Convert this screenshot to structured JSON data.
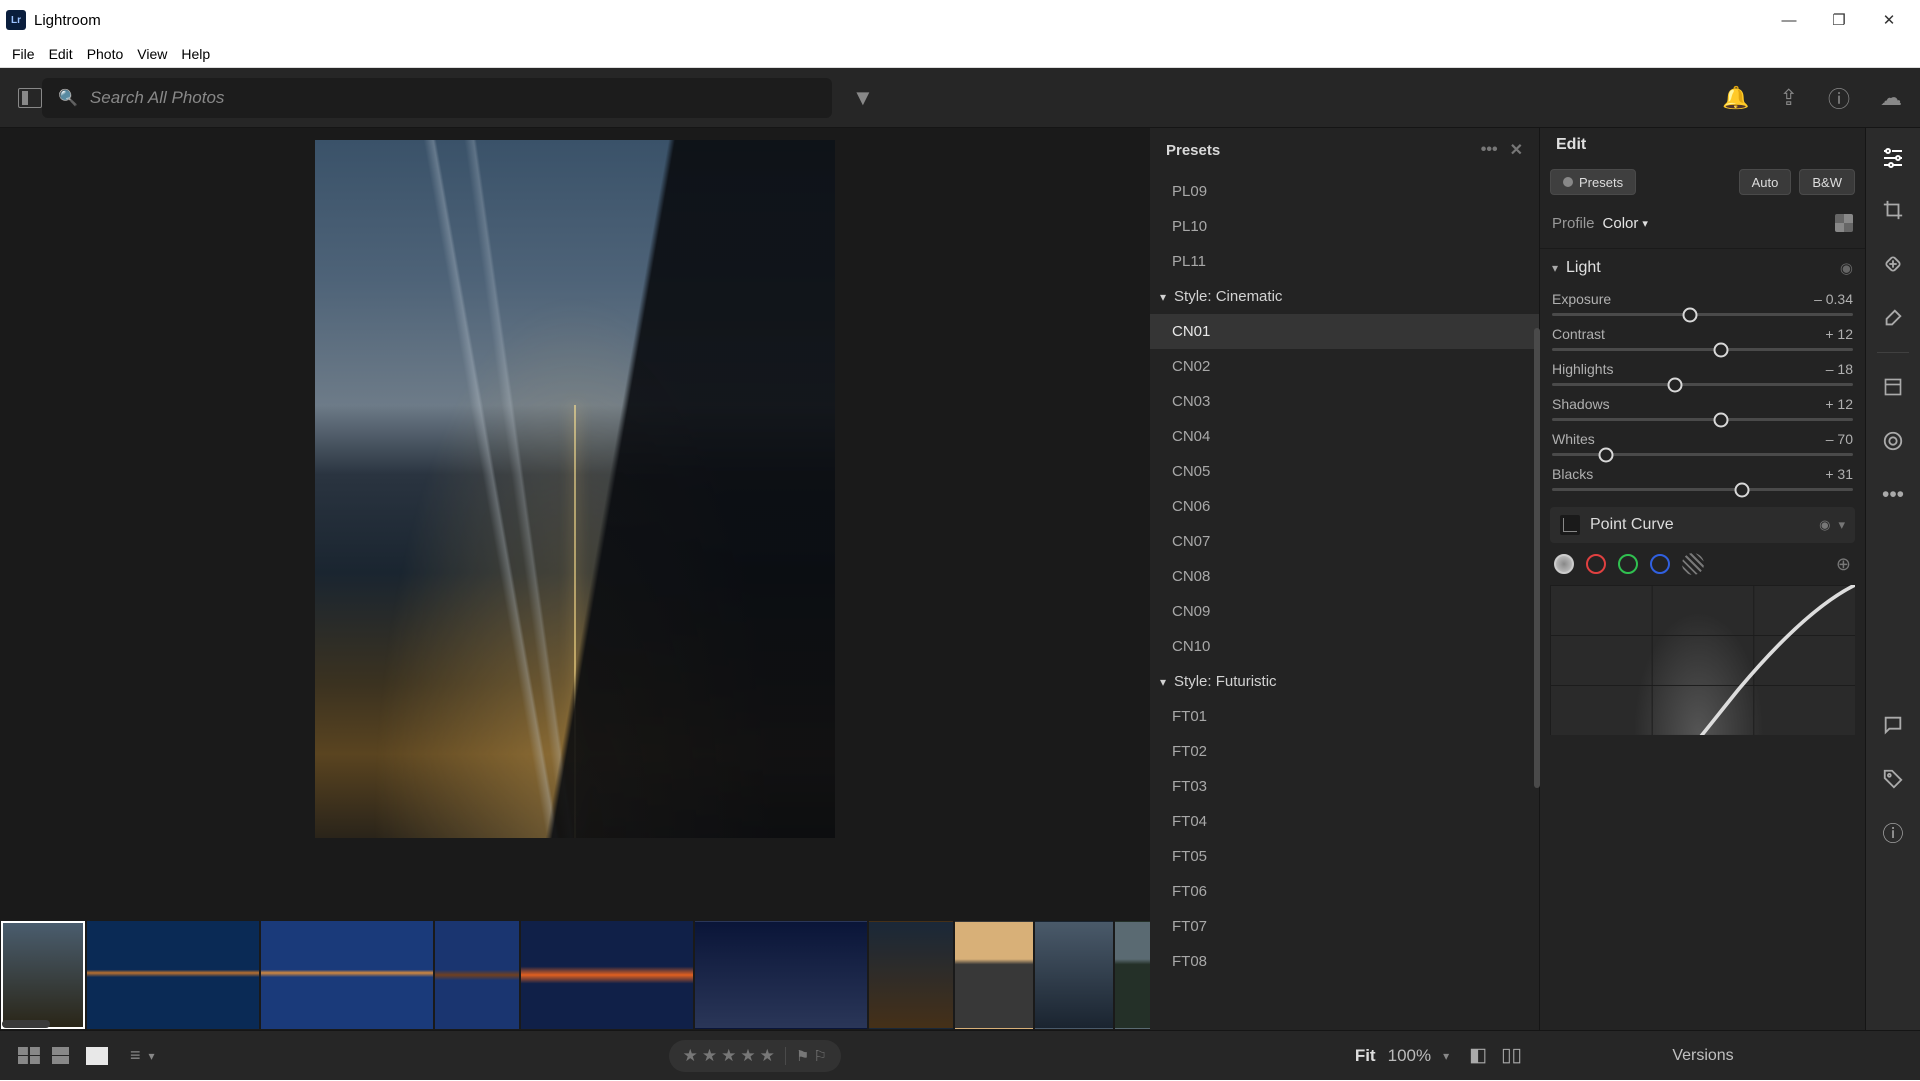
{
  "window": {
    "title": "Lightroom"
  },
  "menu": {
    "file": "File",
    "edit": "Edit",
    "photo": "Photo",
    "view": "View",
    "help": "Help"
  },
  "search": {
    "placeholder": "Search All Photos"
  },
  "presets": {
    "title": "Presets",
    "top_items": [
      "PL09",
      "PL10",
      "PL11"
    ],
    "groups": [
      {
        "label": "Style: Cinematic",
        "items": [
          "CN01",
          "CN02",
          "CN03",
          "CN04",
          "CN05",
          "CN06",
          "CN07",
          "CN08",
          "CN09",
          "CN10"
        ],
        "selected": "CN01"
      },
      {
        "label": "Style: Futuristic",
        "items": [
          "FT01",
          "FT02",
          "FT03",
          "FT04",
          "FT05",
          "FT06",
          "FT07",
          "FT08"
        ]
      }
    ]
  },
  "edit": {
    "title": "Edit",
    "buttons": {
      "presets": "Presets",
      "auto": "Auto",
      "bw": "B&W"
    },
    "profile_label": "Profile",
    "profile_value": "Color",
    "light": {
      "title": "Light",
      "sliders": [
        {
          "label": "Exposure",
          "value": "– 0.34",
          "pos": 46
        },
        {
          "label": "Contrast",
          "value": "+ 12",
          "pos": 56
        },
        {
          "label": "Highlights",
          "value": "– 18",
          "pos": 41
        },
        {
          "label": "Shadows",
          "value": "+ 12",
          "pos": 56
        },
        {
          "label": "Whites",
          "value": "– 70",
          "pos": 18
        },
        {
          "label": "Blacks",
          "value": "+ 31",
          "pos": 63
        }
      ]
    },
    "curve": {
      "title": "Point Curve"
    }
  },
  "bottom": {
    "fit": "Fit",
    "zoom": "100%",
    "versions": "Versions"
  }
}
